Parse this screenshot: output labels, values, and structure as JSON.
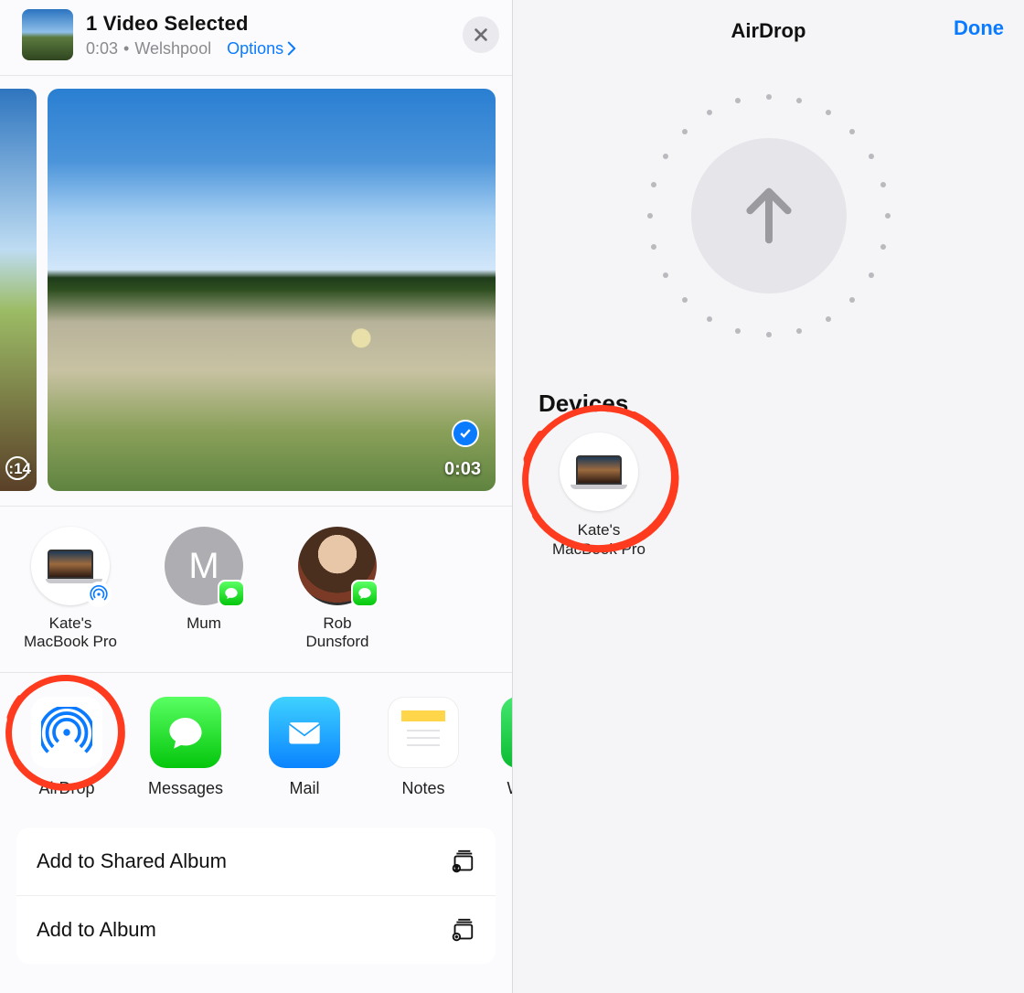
{
  "left": {
    "header": {
      "title": "1 Video Selected",
      "duration": "0:03",
      "dot": "•",
      "location": "Welshpool",
      "options": "Options"
    },
    "previews": {
      "small_duration": ":14",
      "large_duration": "0:03"
    },
    "contacts": [
      {
        "label": "Kate's\nMacBook Pro"
      },
      {
        "initial": "M",
        "label": "Mum"
      },
      {
        "label": "Rob\nDunsford"
      }
    ],
    "apps": {
      "airdrop": "AirDrop",
      "messages": "Messages",
      "mail": "Mail",
      "notes": "Notes",
      "whatsapp_partial": "Wh"
    },
    "actions": {
      "shared_album": "Add to Shared Album",
      "album": "Add to Album"
    }
  },
  "right": {
    "title": "AirDrop",
    "done": "Done",
    "devices_heading": "Devices",
    "device_label": "Kate's\nMacBook Pro"
  }
}
